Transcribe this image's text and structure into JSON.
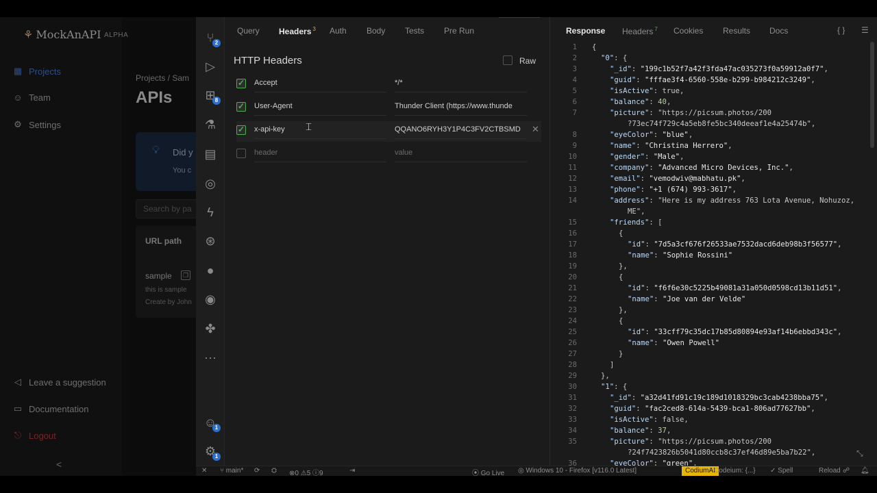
{
  "bg": {
    "logo": "MockAnAPI",
    "badge": "ALPHA",
    "nav": [
      "Projects",
      "Team",
      "Settings"
    ],
    "bottom_nav": [
      "Leave a suggestion",
      "Documentation",
      "Logout"
    ],
    "breadcrumb": "Projects  /  Sam",
    "title": "APIs",
    "card_title": "Did y",
    "card_text": "You c",
    "search_placeholder": "Search by pa",
    "table_header": "URL path",
    "row_path": "sample",
    "row_desc": "this is sample",
    "row_creator": "Create by John"
  },
  "activity": {
    "explorer_badge": "2",
    "extensions_badge": "8",
    "account_badge": "1",
    "settings_badge": "1",
    "more": "···"
  },
  "request": {
    "tabs": [
      "Query",
      "Headers",
      "Auth",
      "Body",
      "Tests",
      "Pre Run"
    ],
    "headers_count": "3",
    "section_title": "HTTP Headers",
    "raw_label": "Raw",
    "headers": [
      {
        "name": "Accept",
        "value": "*/*"
      },
      {
        "name": "User-Agent",
        "value": "Thunder Client (https://www.thunde"
      },
      {
        "name": "x-api-key",
        "value": "QQANO6RYH3Y1P4C3FV2CTBSMD"
      }
    ],
    "new_header_placeholder": "header",
    "new_value_placeholder": "value"
  },
  "response": {
    "tabs": [
      "Response",
      "Headers",
      "Cookies",
      "Results",
      "Docs"
    ],
    "headers_count": "7",
    "braces_icon": "{ }",
    "lines": [
      {
        "n": "1",
        "i": 0,
        "t": "{"
      },
      {
        "n": "2",
        "i": 1,
        "t": "\"0\": {"
      },
      {
        "n": "3",
        "i": 2,
        "t": "\"_id\": \"199c1b52f7a42f3fda47ac035273f0a59912a0f7\","
      },
      {
        "n": "4",
        "i": 2,
        "t": "\"guid\": \"fffae3f4-6560-558e-b299-b984212c3249\","
      },
      {
        "n": "5",
        "i": 2,
        "t": "\"isActive\": true,"
      },
      {
        "n": "6",
        "i": 2,
        "t": "\"balance\": 40,"
      },
      {
        "n": "7",
        "i": 2,
        "t": "\"picture\": \"https://picsum.photos/200"
      },
      {
        "n": "",
        "i": 4,
        "t": "?73ec74f729c4a5eb8fe5bc340deeaf1e4a25474b\","
      },
      {
        "n": "8",
        "i": 2,
        "t": "\"eyeColor\": \"blue\","
      },
      {
        "n": "9",
        "i": 2,
        "t": "\"name\": \"Christina Herrero\","
      },
      {
        "n": "10",
        "i": 2,
        "t": "\"gender\": \"Male\","
      },
      {
        "n": "11",
        "i": 2,
        "t": "\"company\": \"Advanced Micro Devices, Inc.\","
      },
      {
        "n": "12",
        "i": 2,
        "t": "\"email\": \"vemodwiv@mabhatu.pk\","
      },
      {
        "n": "13",
        "i": 2,
        "t": "\"phone\": \"+1 (674) 993-3617\","
      },
      {
        "n": "14",
        "i": 2,
        "t": "\"address\": \"Here is my address 763 Lota Avenue, Nohuzoz,"
      },
      {
        "n": "",
        "i": 4,
        "t": "ME\","
      },
      {
        "n": "15",
        "i": 2,
        "t": "\"friends\": ["
      },
      {
        "n": "16",
        "i": 3,
        "t": "{"
      },
      {
        "n": "17",
        "i": 4,
        "t": "\"id\": \"7d5a3cf676f26533ae7532dacd6deb98b3f56577\","
      },
      {
        "n": "18",
        "i": 4,
        "t": "\"name\": \"Sophie Rossini\""
      },
      {
        "n": "19",
        "i": 3,
        "t": "},"
      },
      {
        "n": "20",
        "i": 3,
        "t": "{"
      },
      {
        "n": "21",
        "i": 4,
        "t": "\"id\": \"f6f6e30c5225b49081a31a050d0598cd13b11d51\","
      },
      {
        "n": "22",
        "i": 4,
        "t": "\"name\": \"Joe van der Velde\""
      },
      {
        "n": "23",
        "i": 3,
        "t": "},"
      },
      {
        "n": "24",
        "i": 3,
        "t": "{"
      },
      {
        "n": "25",
        "i": 4,
        "t": "\"id\": \"33cff79c35dc17b85d80894e93af14b6ebbd343c\","
      },
      {
        "n": "26",
        "i": 4,
        "t": "\"name\": \"Owen Powell\""
      },
      {
        "n": "27",
        "i": 3,
        "t": "}"
      },
      {
        "n": "28",
        "i": 2,
        "t": "]"
      },
      {
        "n": "29",
        "i": 1,
        "t": "},"
      },
      {
        "n": "30",
        "i": 1,
        "t": "\"1\": {"
      },
      {
        "n": "31",
        "i": 2,
        "t": "\"_id\": \"a32d41fd91c19c189d1018329bc3cab4238bba75\","
      },
      {
        "n": "32",
        "i": 2,
        "t": "\"guid\": \"fac2ced8-614a-5439-bca1-806ad77627bb\","
      },
      {
        "n": "33",
        "i": 2,
        "t": "\"isActive\": false,"
      },
      {
        "n": "34",
        "i": 2,
        "t": "\"balance\": 37,"
      },
      {
        "n": "35",
        "i": 2,
        "t": "\"picture\": \"https://picsum.photos/200"
      },
      {
        "n": "",
        "i": 4,
        "t": "?24f7423826b5041d80ccb8c37ef46d89e5ba7b22\","
      },
      {
        "n": "36",
        "i": 2,
        "t": "\"eyeColor\": \"green\","
      }
    ]
  },
  "status": {
    "branch": "main*",
    "problems": "0",
    "warnings": "5",
    "info": "9",
    "go_live": "Go Live",
    "browser": "Windows 10 - Firefox [v116.0 Latest]",
    "codium": "CodiumAI",
    "codeium": "Codeium: {...}",
    "spell": "Spell",
    "reload": "Reload"
  },
  "colors": {
    "accent": "#2b6fcf",
    "check": "#4caf50",
    "badge_orange": "#e6a23c",
    "codium_bg": "#e5b50a"
  }
}
